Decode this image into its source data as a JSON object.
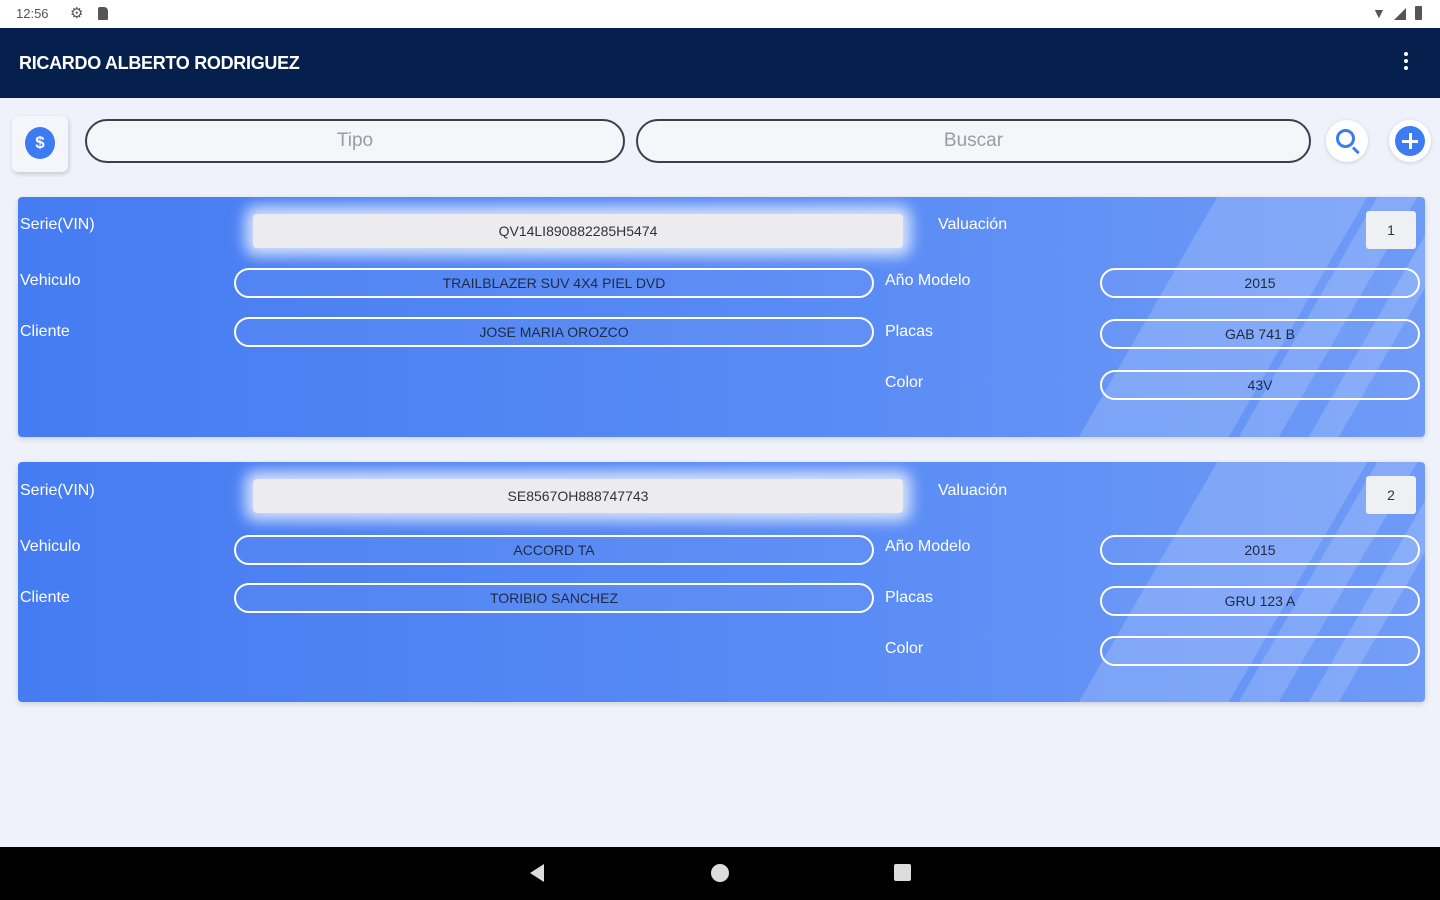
{
  "status_bar": {
    "time": "12:56"
  },
  "app_bar": {
    "title": "RICARDO ALBERTO RODRIGUEZ"
  },
  "toolbar": {
    "tipo_placeholder": "Tipo",
    "buscar_placeholder": "Buscar",
    "money_symbol": "$"
  },
  "colors": {
    "app_bar": "#06204e",
    "card": "#467cf2",
    "accent": "#3d7bf2",
    "background": "#eff2fa"
  },
  "labels": {
    "serie": "Serie(VIN)",
    "vehiculo": "Vehiculo",
    "cliente": "Cliente",
    "valuacion": "Valuación",
    "anio_modelo": "Año Modelo",
    "placas": "Placas",
    "color": "Color"
  },
  "records": [
    {
      "vin": "QV14LI890882285H5474",
      "vehiculo": "TRAILBLAZER SUV 4X4 PIEL DVD",
      "cliente": "JOSE MARIA OROZCO",
      "valuacion": "1",
      "anio_modelo": "2015",
      "placas": "GAB 741 B",
      "color": "43V"
    },
    {
      "vin": "SE8567OH888747743",
      "vehiculo": "ACCORD TA",
      "cliente": "TORIBIO SANCHEZ",
      "valuacion": "2",
      "anio_modelo": "2015",
      "placas": "GRU 123 A",
      "color": ""
    }
  ]
}
